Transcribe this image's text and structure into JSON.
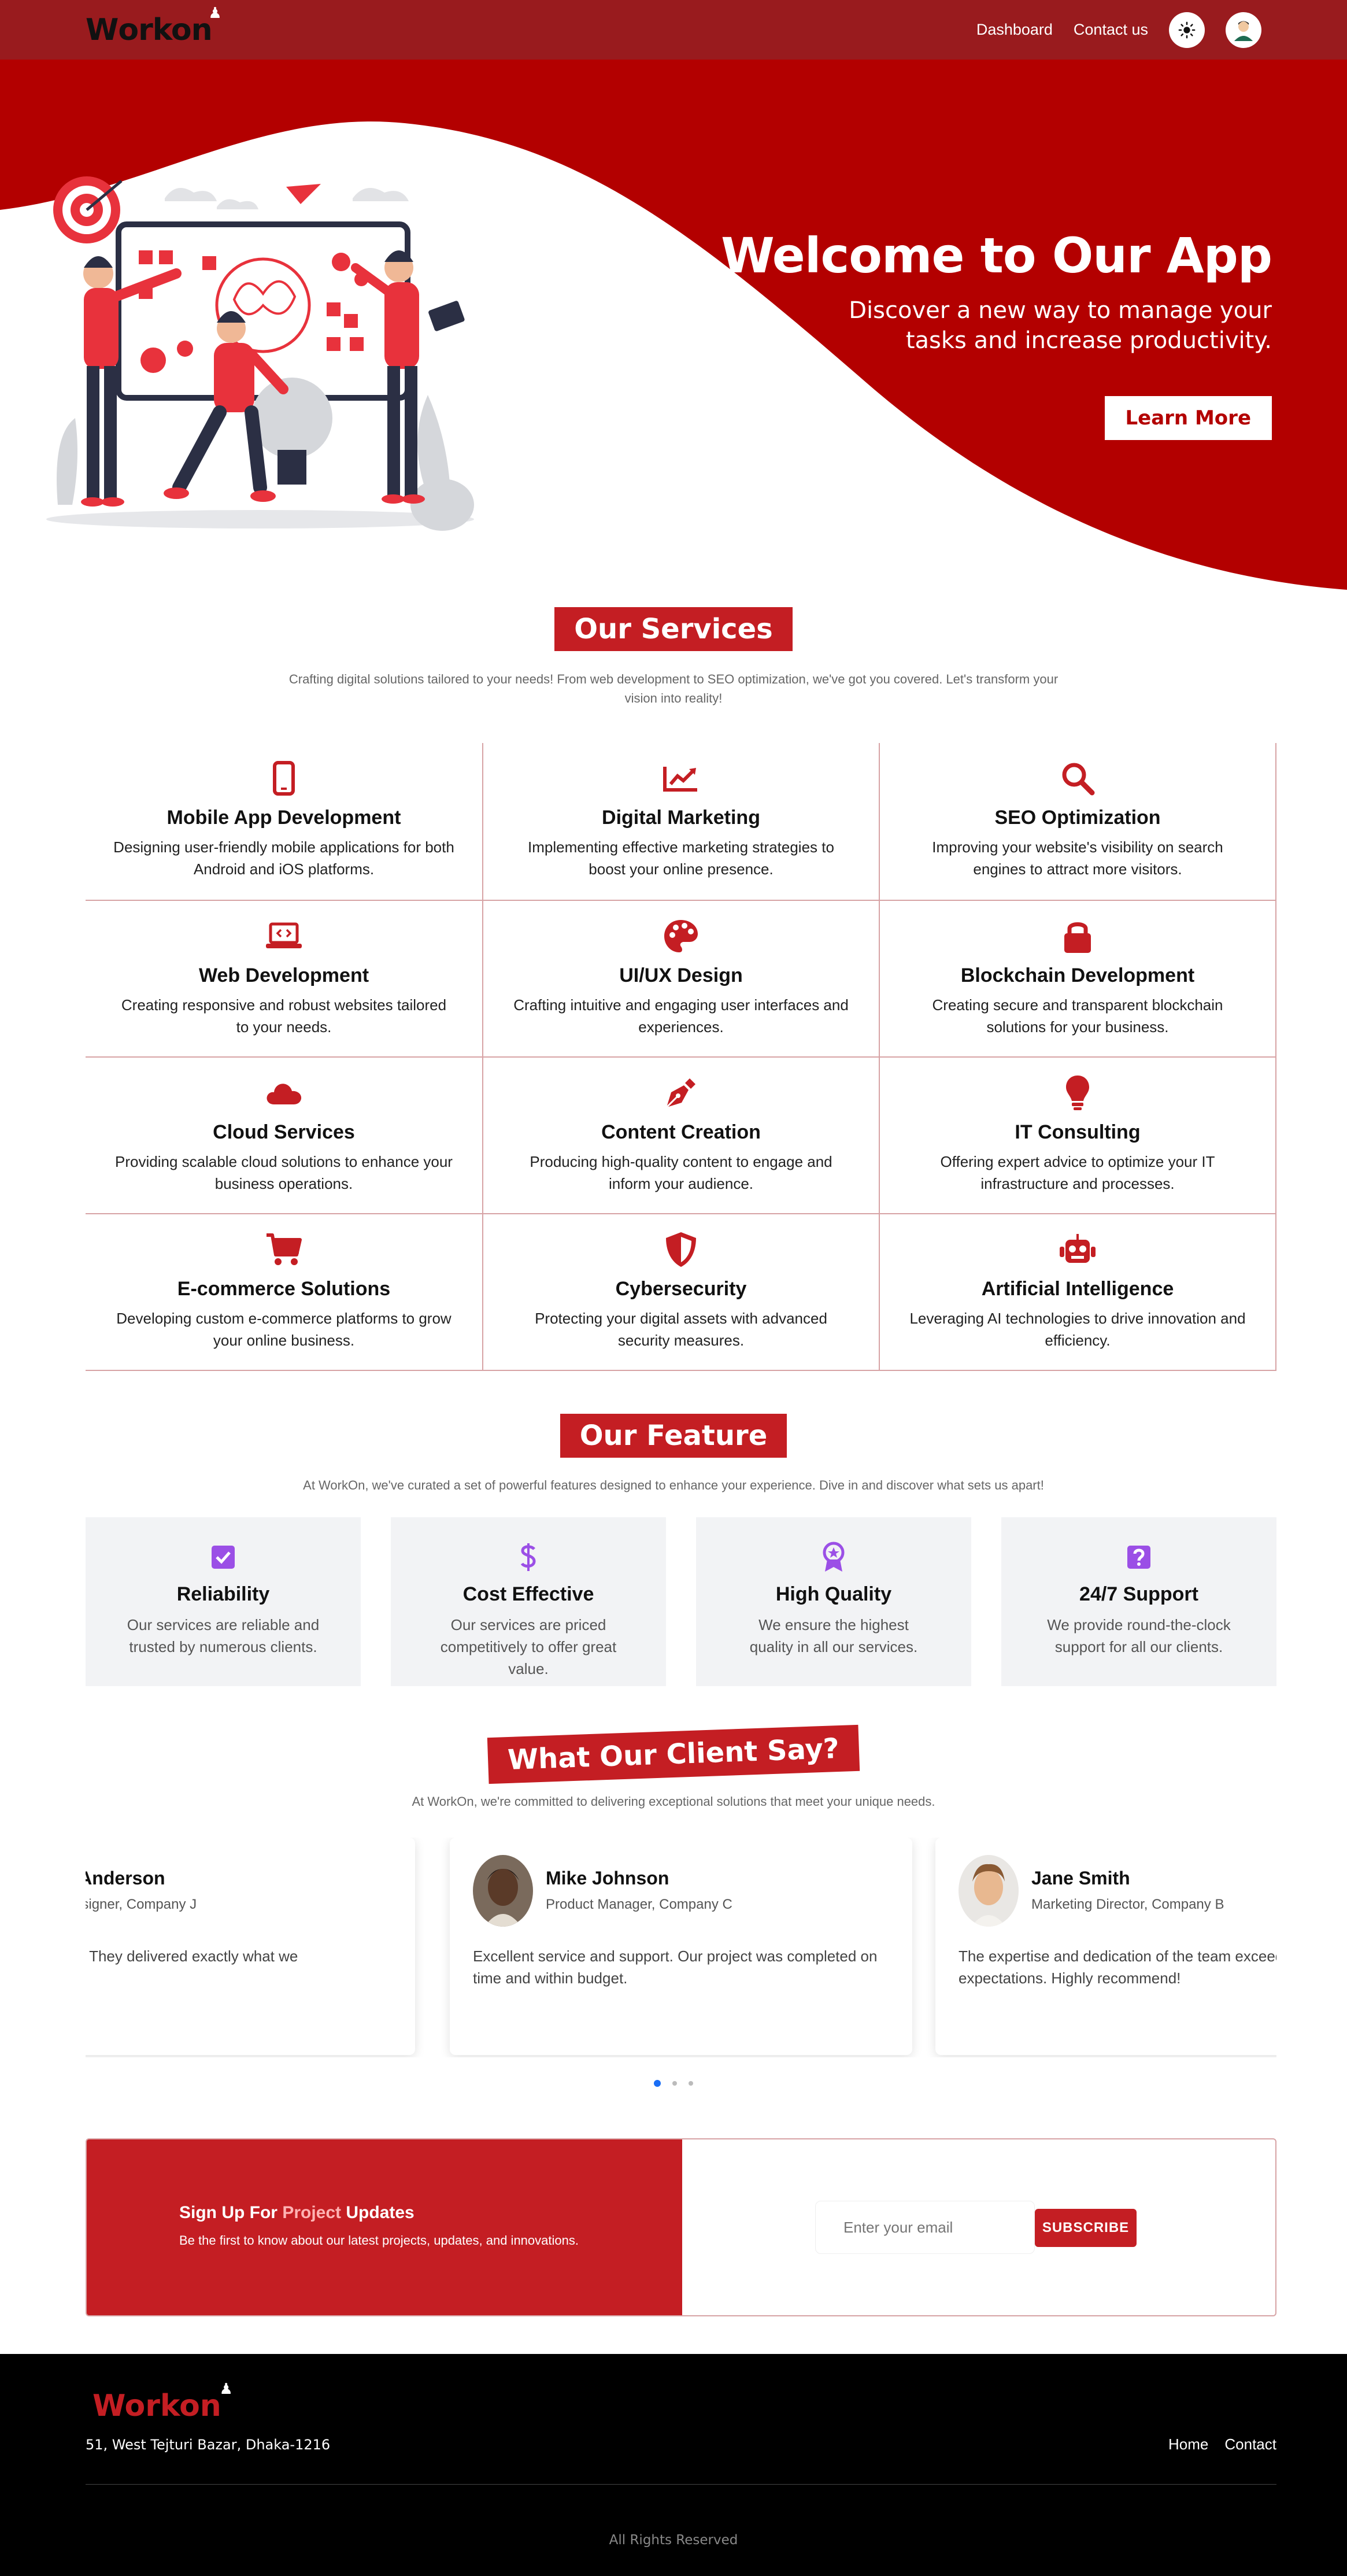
{
  "brand": {
    "logo_w": "W",
    "logo_rest": "orkon",
    "accent": "#c41e23",
    "nav_bg": "#991b1e"
  },
  "nav": {
    "dashboard": "Dashboard",
    "contact": "Contact us"
  },
  "hero": {
    "title": "Welcome to Our App",
    "subtitle": "Discover a new way to manage your tasks and increase productivity.",
    "button": "Learn More"
  },
  "services": {
    "title": "Our Services",
    "subtitle": "Crafting digital solutions tailored to your needs! From web development to SEO optimization, we've got you covered. Let's transform your vision into reality!",
    "items": [
      {
        "icon": "mobile-icon",
        "title": "Mobile App Development",
        "desc": "Designing user-friendly mobile applications for both Android and iOS platforms."
      },
      {
        "icon": "chart-line-icon",
        "title": "Digital Marketing",
        "desc": "Implementing effective marketing strategies to boost your online presence."
      },
      {
        "icon": "search-icon",
        "title": "SEO Optimization",
        "desc": "Improving your website's visibility on search engines to attract more visitors."
      },
      {
        "icon": "laptop-code-icon",
        "title": "Web Development",
        "desc": "Creating responsive and robust websites tailored to your needs."
      },
      {
        "icon": "palette-icon",
        "title": "UI/UX Design",
        "desc": "Crafting intuitive and engaging user interfaces and experiences."
      },
      {
        "icon": "lock-icon",
        "title": "Blockchain Development",
        "desc": "Creating secure and transparent blockchain solutions for your business."
      },
      {
        "icon": "cloud-icon",
        "title": "Cloud Services",
        "desc": "Providing scalable cloud solutions to enhance your business operations."
      },
      {
        "icon": "pen-nib-icon",
        "title": "Content Creation",
        "desc": "Producing high-quality content to engage and inform your audience."
      },
      {
        "icon": "lightbulb-icon",
        "title": "IT Consulting",
        "desc": "Offering expert advice to optimize your IT infrastructure and processes."
      },
      {
        "icon": "cart-icon",
        "title": "E-commerce Solutions",
        "desc": "Developing custom e-commerce platforms to grow your online business."
      },
      {
        "icon": "shield-icon",
        "title": "Cybersecurity",
        "desc": "Protecting your digital assets with advanced security measures."
      },
      {
        "icon": "robot-icon",
        "title": "Artificial Intelligence",
        "desc": "Leveraging AI technologies to drive innovation and efficiency."
      }
    ]
  },
  "features": {
    "title": "Our Feature",
    "subtitle": "At WorkOn, we've curated a set of powerful features designed to enhance your experience. Dive in and discover what sets us apart!",
    "icon_color": "#9b4fe6",
    "items": [
      {
        "icon": "check-square-icon",
        "title": "Reliability",
        "desc": "Our services are reliable and trusted by numerous clients."
      },
      {
        "icon": "dollar-icon",
        "title": "Cost Effective",
        "desc": "Our services are priced competitively to offer great value."
      },
      {
        "icon": "award-icon",
        "title": "High Quality",
        "desc": "We ensure the highest quality in all our services."
      },
      {
        "icon": "question-icon",
        "title": "24/7 Support",
        "desc": "We provide round-the-clock support for all our clients."
      }
    ]
  },
  "testimonials": {
    "title": "What Our Client Say?",
    "subtitle": "At WorkOn, we're committed to delivering exceptional solutions that meet your unique needs.",
    "items": [
      {
        "name": "via Anderson",
        "role": "ef Designer, Company J",
        "quote": "ofessional team. They delivered exactly what we"
      },
      {
        "name": "Mike Johnson",
        "role": "Product Manager, Company C",
        "quote": "Excellent service and support. Our project was completed on time and within budget."
      },
      {
        "name": "Jane Smith",
        "role": "Marketing Director, Company B",
        "quote": "The expertise and dedication of the team exceed expectations. Highly recommend!"
      }
    ]
  },
  "newsletter": {
    "title_pre": "Sign Up For ",
    "title_accent": "Project",
    "title_post": " Updates",
    "desc": "Be the first to know about our latest projects, updates, and innovations.",
    "placeholder": "Enter your email",
    "button": "SUBSCRIBE"
  },
  "footer": {
    "logo_w": "W",
    "logo_rest": "orkon",
    "address": "51, West Tejturi Bazar, Dhaka-1216",
    "links": [
      "Home",
      "Contact"
    ],
    "copyright": "All Rights Reserved"
  }
}
